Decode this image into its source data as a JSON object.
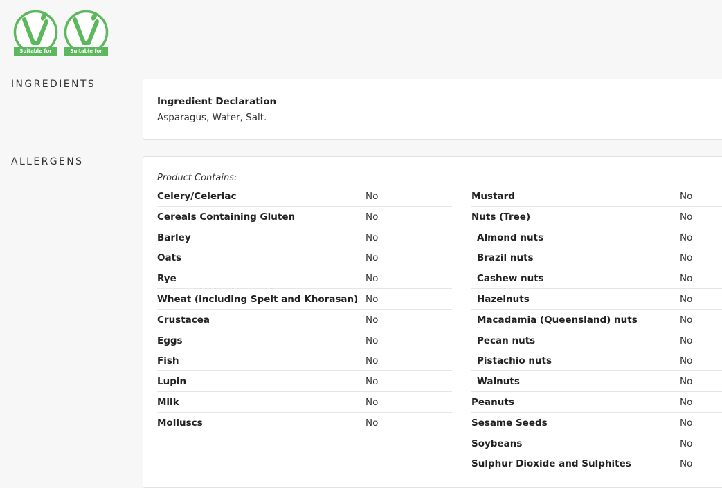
{
  "badges": [
    {
      "text": "Suitable for",
      "icon": "vegetarian-v-icon"
    },
    {
      "text": "Suitable for",
      "icon": "vegan-v-icon"
    }
  ],
  "colors": {
    "badge_green": "#5cb85c",
    "background": "#f7f7f7",
    "card": "#ffffff"
  },
  "ingredients": {
    "section_label": "INGREDIENTS",
    "title": "Ingredient Declaration",
    "text": "Asparagus, Water, Salt."
  },
  "allergens": {
    "section_label": "ALLERGENS",
    "contains_label": "Product Contains:",
    "left": [
      {
        "name": "Celery/Celeriac",
        "value": "No"
      },
      {
        "name": "Cereals Containing Gluten",
        "value": "No"
      },
      {
        "name": "Barley",
        "value": "No"
      },
      {
        "name": "Oats",
        "value": "No"
      },
      {
        "name": "Rye",
        "value": "No"
      },
      {
        "name": "Wheat (including Spelt and Khorasan)",
        "value": "No"
      },
      {
        "name": "Crustacea",
        "value": "No"
      },
      {
        "name": "Eggs",
        "value": "No"
      },
      {
        "name": "Fish",
        "value": "No"
      },
      {
        "name": "Lupin",
        "value": "No"
      },
      {
        "name": "Milk",
        "value": "No"
      },
      {
        "name": "Molluscs",
        "value": "No"
      }
    ],
    "right": [
      {
        "name": "Mustard",
        "value": "No"
      },
      {
        "name": "Nuts (Tree)",
        "value": "No"
      },
      {
        "name": "Almond nuts",
        "value": "No"
      },
      {
        "name": "Brazil nuts",
        "value": "No"
      },
      {
        "name": "Cashew nuts",
        "value": "No"
      },
      {
        "name": "Hazelnuts",
        "value": "No"
      },
      {
        "name": "Macadamia (Queensland) nuts",
        "value": "No"
      },
      {
        "name": "Pecan nuts",
        "value": "No"
      },
      {
        "name": "Pistachio nuts",
        "value": "No"
      },
      {
        "name": "Walnuts",
        "value": "No"
      },
      {
        "name": "Peanuts",
        "value": "No"
      },
      {
        "name": "Sesame Seeds",
        "value": "No"
      },
      {
        "name": "Soybeans",
        "value": "No"
      },
      {
        "name": "Sulphur Dioxide and Sulphites",
        "value": "No"
      }
    ]
  }
}
